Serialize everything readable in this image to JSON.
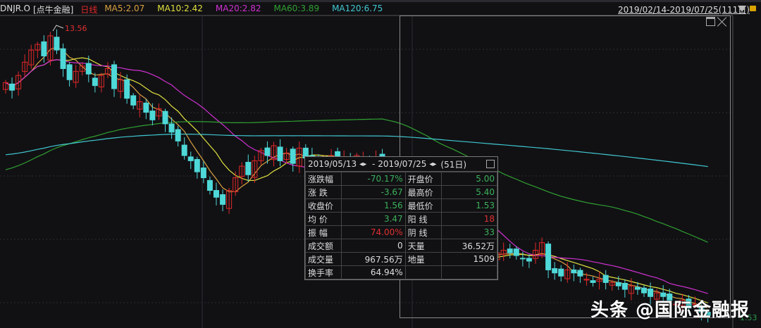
{
  "header": {
    "symbol": "DNJR.O",
    "name": "[点牛金融]",
    "period": "日线",
    "ma5": "MA5:2.07",
    "ma10": "MA10:2.42",
    "ma20": "MA20:2.82",
    "ma60": "MA60:3.89",
    "ma120": "MA120:6.75",
    "range": "2019/02/14-2019/07/25(111日)"
  },
  "colors": {
    "bg": "#111114",
    "up": "#e02828",
    "down": "#4fd8d8",
    "ma5": "#d9a040",
    "ma10": "#e0e040",
    "ma20": "#d030d0",
    "ma60": "#30a030",
    "ma120": "#40c8d0"
  },
  "labels": {
    "peak": "13.56",
    "low": "1.53"
  },
  "stats": {
    "title_start": "2019/05/13",
    "title_end": "2019/07/25",
    "title_days": "(51日)",
    "nav_icon": "◂▸",
    "rows": [
      {
        "k1": "涨跌幅",
        "v1": "-70.17%",
        "c1": "#3cb05a",
        "k2": "开盘价",
        "v2": "5.00",
        "c2": "#3cb05a"
      },
      {
        "k1": "涨  跌",
        "v1": "-3.67",
        "c1": "#3cb05a",
        "k2": "最高价",
        "v2": "5.40",
        "c2": "#3cb05a"
      },
      {
        "k1": "收盘价",
        "v1": "1.56",
        "c1": "#3cb05a",
        "k2": "最低价",
        "v2": "1.53",
        "c2": "#3cb05a"
      },
      {
        "k1": "均  价",
        "v1": "3.47",
        "c1": "#3cb05a",
        "k2": "阳  线",
        "v2": "18",
        "c2": "#e03030"
      },
      {
        "k1": "振  幅",
        "v1": "74.00%",
        "c1": "#e03030",
        "k2": "阴  线",
        "v2": "33",
        "c2": "#3cb05a"
      },
      {
        "k1": "成交额",
        "v1": "0",
        "c1": "#ddd",
        "k2": "天量",
        "v2": "36.52万",
        "c2": "#ddd"
      },
      {
        "k1": "成交量",
        "v1": "967.56万",
        "c1": "#ddd",
        "k2": "地量",
        "v2": "1509",
        "c2": "#ddd"
      },
      {
        "k1": "换手率",
        "v1": "64.94%",
        "c1": "#ddd",
        "k2": "",
        "v2": "",
        "c2": "#ddd"
      }
    ]
  },
  "watermark": "头条 @国际金融报",
  "chart_data": {
    "type": "candlestick",
    "price_scale": "log",
    "ylim": [
      1.53,
      13.56
    ],
    "closes": [
      9.0,
      8.5,
      9.5,
      10.5,
      11.5,
      12.0,
      11.0,
      12.8,
      11.5,
      10.0,
      9.2,
      9.8,
      10.2,
      9.6,
      8.8,
      9.5,
      10.0,
      8.6,
      9.2,
      8.0,
      7.6,
      7.8,
      7.2,
      6.8,
      7.4,
      6.6,
      6.2,
      5.8,
      5.2,
      5.0,
      4.6,
      4.4,
      4.0,
      3.8,
      3.6,
      4.0,
      4.4,
      4.8,
      4.5,
      5.0,
      5.4,
      5.2,
      5.6,
      5.0,
      5.3,
      4.9,
      5.5,
      5.1,
      5.2,
      5.0,
      5.1,
      5.2,
      5.0,
      5.1,
      5.0,
      5.2,
      5.1,
      5.0,
      5.1,
      5.0,
      4.6,
      4.0,
      3.5,
      3.1,
      2.8,
      2.6,
      2.4,
      2.3,
      2.35,
      2.3,
      2.35,
      2.4,
      2.5,
      2.45,
      2.5,
      2.4,
      2.45,
      2.5,
      2.55,
      2.5,
      2.45,
      2.4,
      2.35,
      2.55,
      2.7,
      2.2,
      2.15,
      2.1,
      2.2,
      2.15,
      2.1,
      2.05,
      2.0,
      2.05,
      2.0,
      2.0,
      1.95,
      1.9,
      1.95,
      1.9,
      1.85,
      1.8,
      1.85,
      1.8,
      1.75,
      1.7,
      1.75,
      1.65,
      1.7,
      1.6,
      1.56
    ]
  }
}
